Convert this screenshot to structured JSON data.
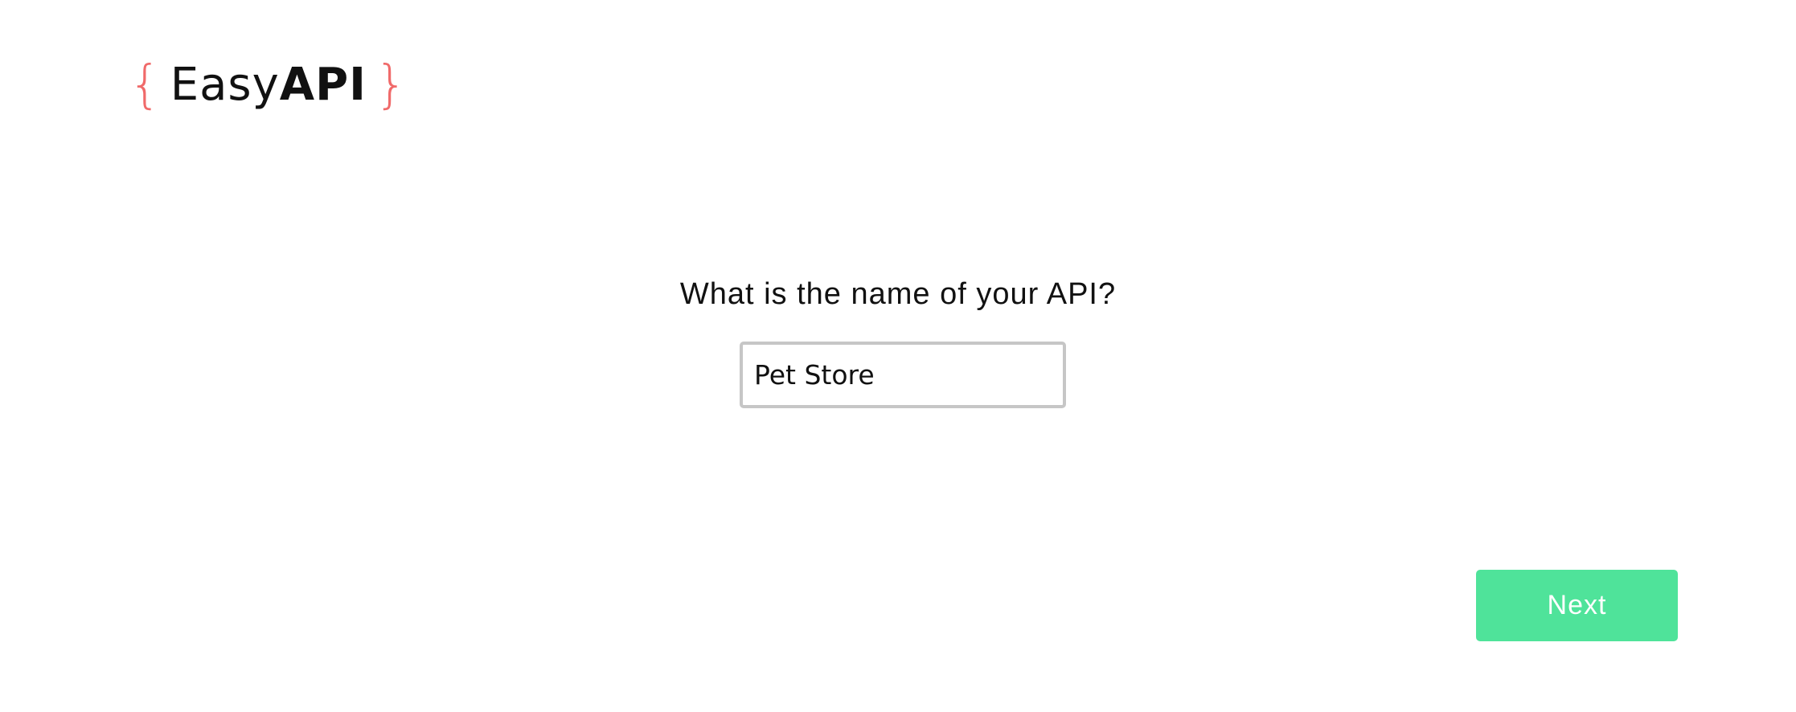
{
  "logo": {
    "brace_left": "{",
    "word_light": "Easy",
    "word_bold": "API",
    "brace_right": "}"
  },
  "form": {
    "question": "What is the name of your API?",
    "api_name_value": "Pet Store",
    "next_label": "Next"
  },
  "colors": {
    "brand_brace": "#f06a6a",
    "next_button_bg": "#4fe39a",
    "input_border": "#c6c6c6"
  }
}
